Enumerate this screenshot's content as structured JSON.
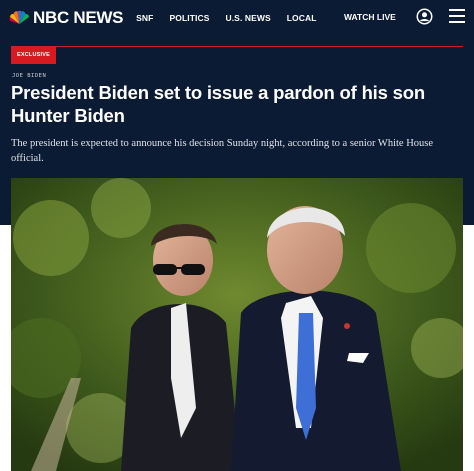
{
  "brand": {
    "name": "NBC NEWS"
  },
  "nav": {
    "links": [
      "SNF",
      "POLITICS",
      "U.S. NEWS",
      "LOCAL"
    ],
    "watch_live": "WATCH LIVE"
  },
  "article": {
    "badge": "EXCLUSIVE",
    "kicker": "JOE BIDEN",
    "headline": "President Biden set to issue a pardon of his son Hunter Biden",
    "dek": "The president is expected to announce his decision Sunday night, according to a senior White House official."
  },
  "icons": {
    "logo": "nbc-peacock-icon",
    "account": "user-icon",
    "menu": "hamburger-menu-icon"
  },
  "colors": {
    "nav_bg": "#0b1b33",
    "accent_red": "#d71920",
    "text": "#ffffff"
  }
}
